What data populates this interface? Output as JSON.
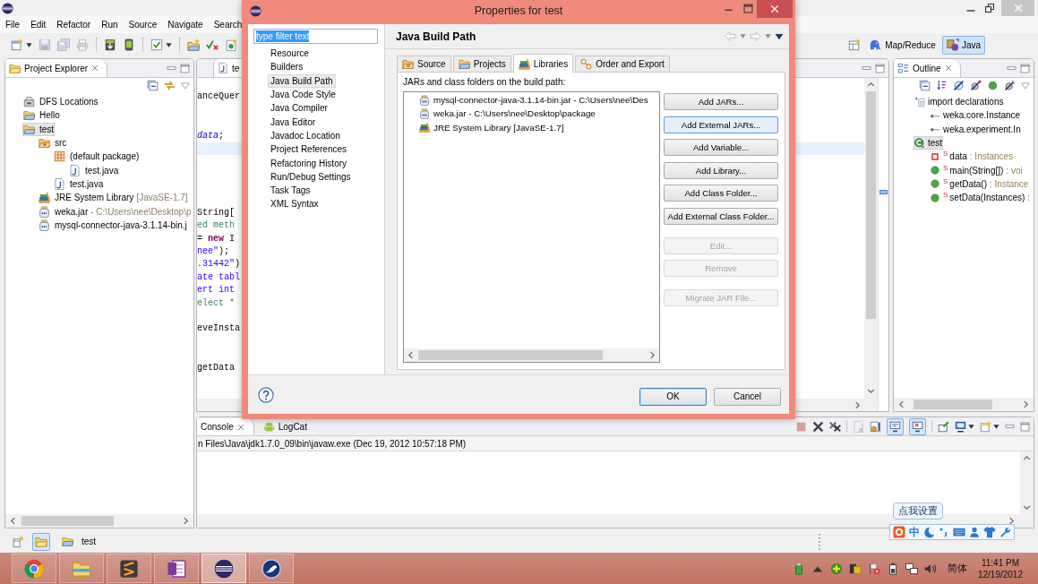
{
  "eclipse": {
    "menu": [
      "File",
      "Edit",
      "Refactor",
      "Run",
      "Source",
      "Navigate",
      "Search"
    ],
    "toolbar": [
      [
        {
          "kind": "new",
          "disabled": false
        },
        {
          "kind": "save",
          "disabled": true
        },
        {
          "kind": "save_all",
          "disabled": true
        },
        {
          "kind": "print",
          "disabled": true
        }
      ],
      [
        {
          "kind": "sdk_manager",
          "disabled": false
        },
        {
          "kind": "device_manager",
          "disabled": false
        }
      ],
      [
        {
          "kind": "checklist",
          "disabled": false
        }
      ],
      [
        {
          "kind": "new_project",
          "disabled": false
        },
        {
          "kind": "run_tests",
          "disabled": false
        },
        {
          "kind": "new_class",
          "disabled": false
        }
      ]
    ],
    "perspectives": [
      {
        "kind": "map_reduce",
        "label": "Map/Reduce",
        "selected": false
      },
      {
        "kind": "java",
        "label": "Java",
        "selected": true
      }
    ],
    "project_explorer": {
      "title": "Project Explorer",
      "tree": [
        {
          "kind": "server",
          "label": "DFS Locations",
          "selected": false
        },
        {
          "kind": "project",
          "label": "Hello",
          "selected": false
        },
        {
          "kind": "project",
          "label": "test",
          "selected": true,
          "children": [
            {
              "kind": "source_folder",
              "label": "src",
              "selected": false,
              "children": [
                {
                  "kind": "package",
                  "label": "(default package)",
                  "selected": false,
                  "children": [
                    {
                      "kind": "java_file",
                      "label": "test.java",
                      "selected": false
                    }
                  ]
                },
                {
                  "kind": "java_file",
                  "label": "test.java",
                  "selected": false
                }
              ]
            },
            {
              "kind": "library",
              "label": "JRE System Library",
              "decoration": "[JavaSE-1.7]",
              "selected": false
            },
            {
              "kind": "jar",
              "label": "weka.jar",
              "decoration": "- C:\\Users\\nee\\Desktop\\p",
              "selected": false
            },
            {
              "kind": "jar",
              "label": "mysql-connector-java-3.1.14-bin.j",
              "selected": false
            }
          ]
        }
      ]
    },
    "editor": {
      "tab": "te",
      "lines": [
        {
          "kind": "blank",
          "current": false
        },
        {
          "kind": "code",
          "current": false,
          "segments": [
            {
              "kind": "plain",
              "text": "anceQuer"
            }
          ]
        },
        {
          "kind": "blank",
          "current": false
        },
        {
          "kind": "blank",
          "current": false
        },
        {
          "kind": "code",
          "current": false,
          "segments": [
            {
              "kind": "field",
              "text": "data"
            },
            {
              "kind": "plain",
              "text": ";"
            }
          ]
        },
        {
          "kind": "blank",
          "current": true
        },
        {
          "kind": "blank",
          "current": false
        },
        {
          "kind": "blank",
          "current": false
        },
        {
          "kind": "blank",
          "current": false
        },
        {
          "kind": "blank",
          "current": false
        },
        {
          "kind": "code",
          "current": false,
          "segments": [
            {
              "kind": "plain",
              "text": "String["
            }
          ]
        },
        {
          "kind": "code",
          "current": false,
          "segments": [
            {
              "kind": "comment",
              "text": "ed meth"
            }
          ]
        },
        {
          "kind": "code",
          "current": false,
          "segments": [
            {
              "kind": "plain",
              "text": "= "
            },
            {
              "kind": "keyword",
              "text": "new"
            },
            {
              "kind": "plain",
              "text": " I"
            }
          ]
        },
        {
          "kind": "code",
          "current": false,
          "segments": [
            {
              "kind": "string",
              "text": "nee\""
            },
            {
              "kind": "plain",
              "text": ");"
            }
          ]
        },
        {
          "kind": "code",
          "current": false,
          "segments": [
            {
              "kind": "string",
              "text": ".31442\""
            },
            {
              "kind": "plain",
              "text": ")"
            }
          ]
        },
        {
          "kind": "code",
          "current": false,
          "segments": [
            {
              "kind": "string",
              "text": "ate tabl"
            }
          ]
        },
        {
          "kind": "code",
          "current": false,
          "segments": [
            {
              "kind": "string",
              "text": "ert int"
            }
          ]
        },
        {
          "kind": "code",
          "current": false,
          "segments": [
            {
              "kind": "comment",
              "text": "elect *"
            }
          ]
        },
        {
          "kind": "blank",
          "current": false
        },
        {
          "kind": "code",
          "current": false,
          "segments": [
            {
              "kind": "plain",
              "text": "eveInsta"
            }
          ]
        },
        {
          "kind": "blank",
          "current": false
        },
        {
          "kind": "blank",
          "current": false
        },
        {
          "kind": "code",
          "current": false,
          "segments": [
            {
              "kind": "plain",
              "text": "getData"
            }
          ]
        }
      ]
    },
    "outline": {
      "title": "Outline",
      "tree": [
        {
          "kind": "imports",
          "label": "import declarations",
          "selected": false,
          "children": [
            {
              "kind": "import",
              "label": "weka.core.Instance",
              "selected": false
            },
            {
              "kind": "import",
              "label": "weka.experiment.In",
              "selected": false
            }
          ]
        },
        {
          "kind": "class",
          "label": "test",
          "selected": true,
          "children": [
            {
              "kind": "field",
              "modifier": "S",
              "label": "data",
              "decoration": ": Instances",
              "selected": false
            },
            {
              "kind": "method",
              "modifier": "S",
              "label": "main(String[])",
              "decoration": ": voi",
              "selected": false
            },
            {
              "kind": "method",
              "modifier": "S",
              "label": "getData()",
              "decoration": ": Instance",
              "selected": false
            },
            {
              "kind": "method",
              "modifier": "S",
              "label": "setData(Instances)",
              "decoration": ":",
              "selected": false
            }
          ]
        }
      ]
    },
    "console": {
      "tabs": [
        {
          "kind": "console",
          "label": "Console",
          "selected": true
        },
        {
          "kind": "logcat",
          "label": "LogCat",
          "selected": false
        }
      ],
      "toolbar": [
        [
          {
            "kind": "stop",
            "pressed": false,
            "disabled": true
          },
          {
            "kind": "remove",
            "pressed": false,
            "disabled": false
          },
          {
            "kind": "remove_all",
            "pressed": false,
            "disabled": false
          }
        ],
        [
          {
            "kind": "clear",
            "pressed": false,
            "disabled": true
          },
          {
            "kind": "scroll_lock",
            "pressed": false,
            "disabled": false
          },
          {
            "kind": "show_output",
            "pressed": true,
            "disabled": false
          },
          {
            "kind": "show_error",
            "pressed": true,
            "disabled": false
          }
        ],
        [
          {
            "kind": "pin",
            "pressed": false,
            "disabled": false
          },
          {
            "kind": "display",
            "pressed": false,
            "disabled": false
          },
          {
            "kind": "new_console",
            "pressed": false,
            "disabled": false
          }
        ]
      ],
      "description": "n Files\\Java\\jdk1.7.0_09\\bin\\javaw.exe (Dec 19, 2012 10:57:18 PM)"
    },
    "status_bar": {
      "trim": [
        {
          "kind": "new_view",
          "pressed": false
        },
        {
          "kind": "folder",
          "pressed": true
        }
      ],
      "selection": {
        "kind": "project",
        "label": "test"
      }
    }
  },
  "dialog": {
    "title": "Properties for test",
    "filter": {
      "value": "type filter text",
      "text_selected": true
    },
    "nav": [
      {
        "label": "Resource",
        "selected": false
      },
      {
        "label": "Builders",
        "selected": false
      },
      {
        "label": "Java Build Path",
        "selected": true
      },
      {
        "label": "Java Code Style",
        "selected": false
      },
      {
        "label": "Java Compiler",
        "selected": false
      },
      {
        "label": "Java Editor",
        "selected": false
      },
      {
        "label": "Javadoc Location",
        "selected": false
      },
      {
        "label": "Project References",
        "selected": false
      },
      {
        "label": "Refactoring History",
        "selected": false
      },
      {
        "label": "Run/Debug Settings",
        "selected": false
      },
      {
        "label": "Task Tags",
        "selected": false
      },
      {
        "label": "XML Syntax",
        "selected": false
      }
    ],
    "page_title": "Java Build Path",
    "tabs": [
      {
        "kind": "source",
        "label": "Source",
        "selected": false
      },
      {
        "kind": "projects",
        "label": "Projects",
        "selected": false
      },
      {
        "kind": "libraries",
        "label": "Libraries",
        "selected": true
      },
      {
        "kind": "order",
        "label": "Order and Export",
        "selected": false
      }
    ],
    "list_label": "JARs and class folders on the build path:",
    "entries": [
      {
        "kind": "jar",
        "label": "mysql-connector-java-3.1.14-bin.jar - C:\\Users\\nee\\Des"
      },
      {
        "kind": "jar",
        "label": "weka.jar - C:\\Users\\nee\\Desktop\\package"
      },
      {
        "kind": "library",
        "label": "JRE System Library [JavaSE-1.7]"
      }
    ],
    "buttons": [
      [
        {
          "label": "Add JARs...",
          "disabled": false,
          "focused": false
        },
        {
          "label": "Add External JARs...",
          "disabled": false,
          "focused": true
        },
        {
          "label": "Add Variable...",
          "disabled": false,
          "focused": false
        },
        {
          "label": "Add Library...",
          "disabled": false,
          "focused": false
        },
        {
          "label": "Add Class Folder...",
          "disabled": false,
          "focused": false
        },
        {
          "label": "Add External Class Folder...",
          "disabled": false,
          "focused": false
        }
      ],
      [
        {
          "label": "Edit...",
          "disabled": true,
          "focused": false
        },
        {
          "label": "Remove",
          "disabled": true,
          "focused": false
        }
      ],
      [
        {
          "label": "Migrate JAR File...",
          "disabled": true,
          "focused": false
        }
      ]
    ],
    "footer_buttons": [
      {
        "label": "OK",
        "default": true
      },
      {
        "label": "Cancel",
        "default": false
      }
    ]
  },
  "ime": {
    "tooltip": "点我设置",
    "mode": "中"
  },
  "taskbar": {
    "apps": [
      {
        "kind": "browser",
        "active": false
      },
      {
        "kind": "files",
        "active": false
      },
      {
        "kind": "text_editor",
        "active": false
      },
      {
        "kind": "notebook",
        "active": false
      },
      {
        "kind": "eclipse",
        "active": true
      },
      {
        "kind": "bird",
        "active": false
      }
    ],
    "language": "简体",
    "time": "11:41 PM",
    "date": "12/19/2012"
  }
}
